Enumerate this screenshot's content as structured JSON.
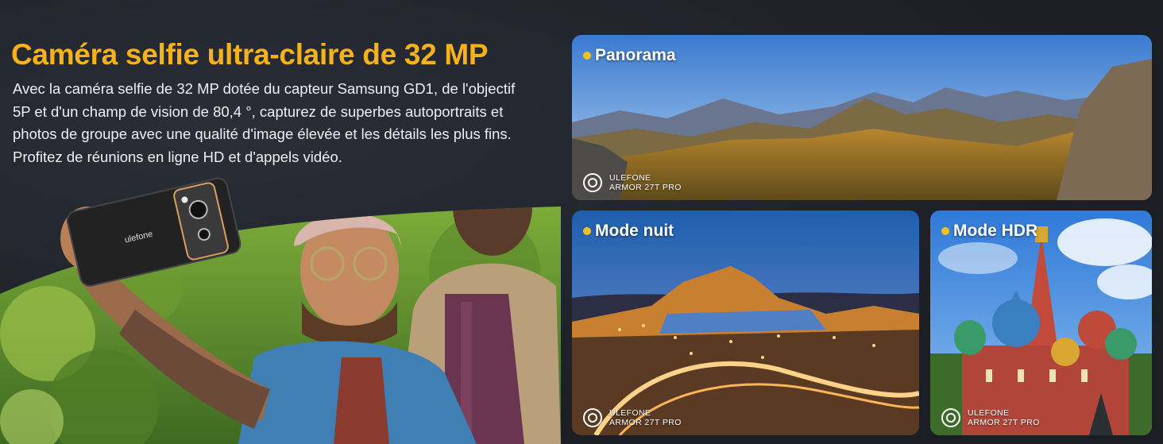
{
  "headline": "Caméra selfie ultra-claire de 32 MP",
  "description_lines": [
    "Avec la caméra selfie de 32 MP dotée du capteur Samsung GD1, de l'objectif",
    "5P et d'un champ de vision de 80,4 °, capturez de superbes autoportraits et",
    "photos de groupe avec une qualité d'image élevée et les détails les plus fins.",
    "Profitez de réunions en ligne HD et d'appels vidéo."
  ],
  "phone_brand": "ulefone",
  "cards": [
    {
      "label": "Panorama",
      "watermark_brand": "ULEFONE",
      "watermark_model": "ARMOR 27T PRO"
    },
    {
      "label": "Mode nuit",
      "watermark_brand": "ULEFONE",
      "watermark_model": "ARMOR 27T PRO"
    },
    {
      "label": "Mode HDR",
      "watermark_brand": "ULEFONE",
      "watermark_model": "ARMOR 27T PRO"
    }
  ],
  "colors": {
    "headline": "#f5b21c",
    "background": "#1e2128",
    "label_dot": "#f5c21c"
  }
}
